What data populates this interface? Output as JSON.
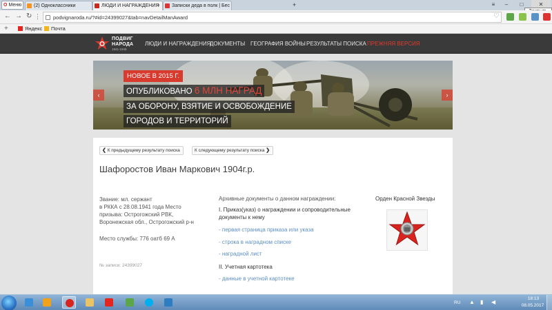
{
  "browser": {
    "menu_label": "Меню",
    "tabs": [
      {
        "label": "(2) Одноклассники"
      },
      {
        "label": "ЛЮДИ И НАГРАЖДЕНИЯ"
      },
      {
        "label": "Записки деда в полк | Бес"
      }
    ],
    "new_tab_symbol": "+",
    "address": "podvignaroda.ru/?#id=24399027&tab=navDetailManAward",
    "close_tooltip": "Закрыть",
    "bookmarks": [
      {
        "label": "Яндекс"
      },
      {
        "label": "Почта"
      }
    ]
  },
  "site": {
    "logo": {
      "line1": "ПОДВИГ",
      "line2": "НАРОДА",
      "years": "1941-1945"
    },
    "menu": [
      {
        "label": "ЛЮДИ И НАГРАЖДЕНИЯ"
      },
      {
        "label": "ДОКУМЕНТЫ"
      },
      {
        "label": "ГЕОГРАФИЯ ВОЙНЫ"
      },
      {
        "label": "РЕЗУЛЬТАТЫ ПОИСКА"
      },
      {
        "label": "ПРЕЖНЯЯ ВЕРСИЯ"
      }
    ],
    "accent_color": "#d83a2e"
  },
  "banner": {
    "badge": "НОВОЕ В 2015 Г.",
    "line1_prefix": "ОПУБЛИКОВАНО",
    "line1_highlight": "6 МЛН НАГРАД",
    "line2": "ЗА ОБОРОНУ, ВЗЯТИЕ И ОСВОБОЖДЕНИЕ",
    "line3": "ГОРОДОВ И ТЕРРИТОРИЙ",
    "prev_arrow": "‹",
    "next_arrow": "›"
  },
  "record": {
    "prev_label": "К предыдущему результату поиска",
    "next_label": "К следующему результату поиска",
    "prev_arrow": "❮",
    "next_arrow": "❯",
    "person_name": "Шафоростов Иван Маркович 1904г.р.",
    "info_lines": [
      "Звание: мл. сержант",
      "в РККА с 28.08.1941 года Место",
      "призыва: Острогожский РВК,",
      "Воронежская обл., Острогожский р-н"
    ],
    "service_place": "Место службы: 776 оатб 69 А",
    "record_number": "№ записи: 24399027",
    "docs_heading": "Архивные документы о данном награждении:",
    "section1_line1": "I. Приказ(указ) о награждении и сопроводительные",
    "section1_line2": "документы к нему",
    "links1": [
      "- первая страница приказа или указа",
      "- строка в наградном списке",
      "- наградной лист"
    ],
    "section2": "II. Учетная картотека",
    "links2": [
      "- данные в учетной картотеке"
    ],
    "award_title": "Орден Красной Звезды"
  },
  "taskbar": {
    "lang": "RU",
    "time": "18:13",
    "date": "08.05.2017"
  }
}
